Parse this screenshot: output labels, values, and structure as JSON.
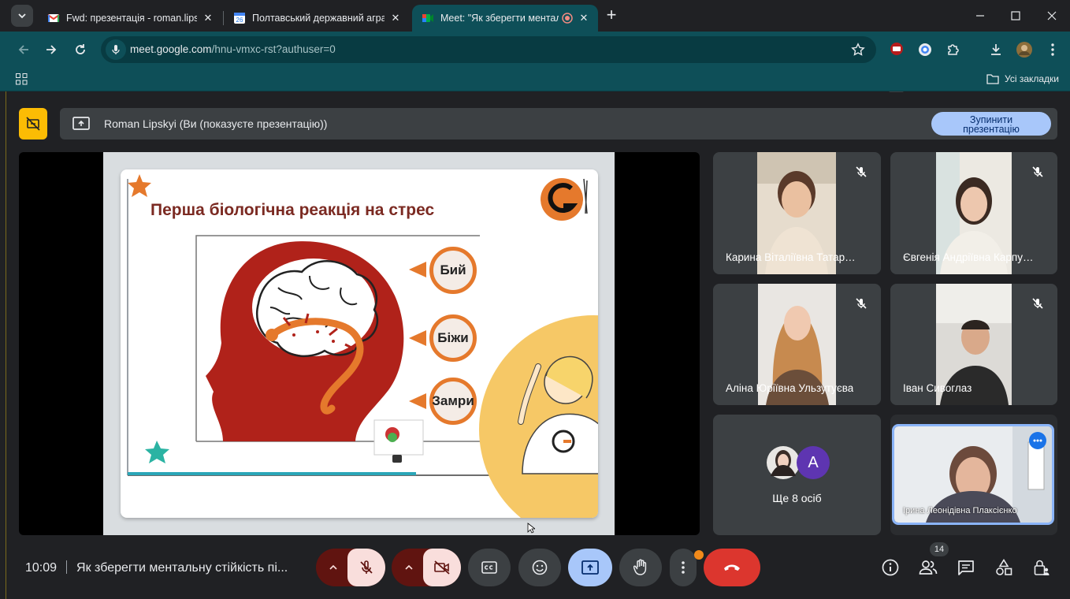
{
  "browser": {
    "tabs": [
      {
        "title": "Fwd: презентація - roman.lipsk",
        "favicon": "gmail-icon"
      },
      {
        "title": "Полтавський державний аграр",
        "favicon": "calendar-icon",
        "favicon_text": "26"
      },
      {
        "title": "Meet: \"Як зберегти ментал",
        "favicon": "meet-icon",
        "active": true
      }
    ],
    "url_host": "meet.google.com",
    "url_path": "/hnu-vmxc-rst?authuser=0",
    "extension_badge": "191",
    "bookmarks_all_label": "Усі закладки"
  },
  "meet": {
    "presenting_badge_icon": "presentation-off-icon",
    "presenting_text": "Roman Lipskyi (Ви (показуєте презентацію))",
    "stop_button_label": "Зупинити\nпрезентацію",
    "slide": {
      "title": "Перша біологічна реакція на стрес",
      "words": [
        "Бий",
        "Біжи",
        "Замри"
      ],
      "logo_letter": "G"
    },
    "participants": [
      {
        "name": "Карина Віталіївна Татар…",
        "muted": true
      },
      {
        "name": "Євгенія Андріївна Карпу…",
        "muted": true
      },
      {
        "name": "Аліна Юріївна Ульзутуєва",
        "muted": true
      },
      {
        "name": "Іван Сивоглаз",
        "muted": true
      }
    ],
    "others": {
      "avatar_letter": "A",
      "label": "Ще 8 осіб"
    },
    "self_view_name": "Ірина Леонідівна Плаксієнко",
    "clock": "10:09",
    "meeting_title": "Як зберегти ментальну стійкість пі...",
    "participant_count": "14",
    "colors": {
      "accent_blue": "#a8c7fa",
      "end_call_red": "#dc362e",
      "muted_bg": "#f9dedc",
      "chrome_teal": "#0e4f58",
      "presenting_yellow": "#fbbc04"
    }
  }
}
